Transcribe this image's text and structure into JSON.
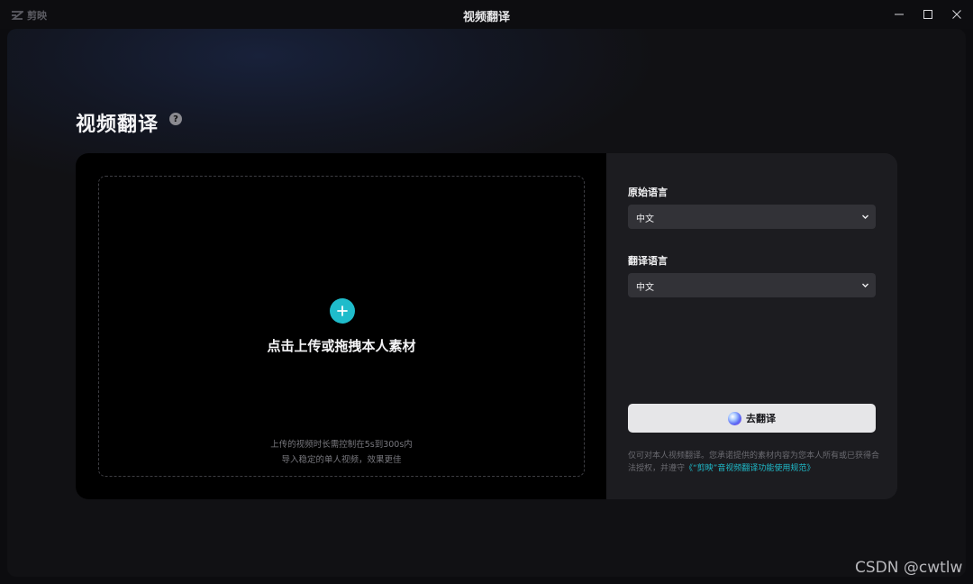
{
  "titlebar": {
    "app_name": "剪映",
    "window_title": "视频翻译"
  },
  "page": {
    "title": "视频翻译",
    "help_glyph": "?"
  },
  "upload": {
    "label": "点击上传或拖拽本人素材",
    "hint_line1": "上传的视频时长需控制在5s到300s内",
    "hint_line2": "导入稳定的单人视频，效果更佳"
  },
  "settings": {
    "source_label": "原始语言",
    "source_value": "中文",
    "target_label": "翻译语言",
    "target_value": "中文",
    "translate_button": "去翻译",
    "disclaimer_text": "仅可对本人视频翻译。您承诺提供的素材内容为您本人所有或已获得合法授权，并遵守",
    "disclaimer_link": "《“剪映”音视频翻译功能使用规范》"
  },
  "watermark": "CSDN @cwtlw",
  "colors": {
    "accent": "#1fbccb",
    "card_bg": "#1c1c20",
    "upload_bg": "#000000",
    "button_bg": "#e6e6e8"
  },
  "icons": [
    "jianying-logo-icon",
    "minimize-icon",
    "maximize-icon",
    "close-icon",
    "help-icon",
    "plus-icon",
    "chevron-down-icon",
    "ai-orb-icon"
  ]
}
